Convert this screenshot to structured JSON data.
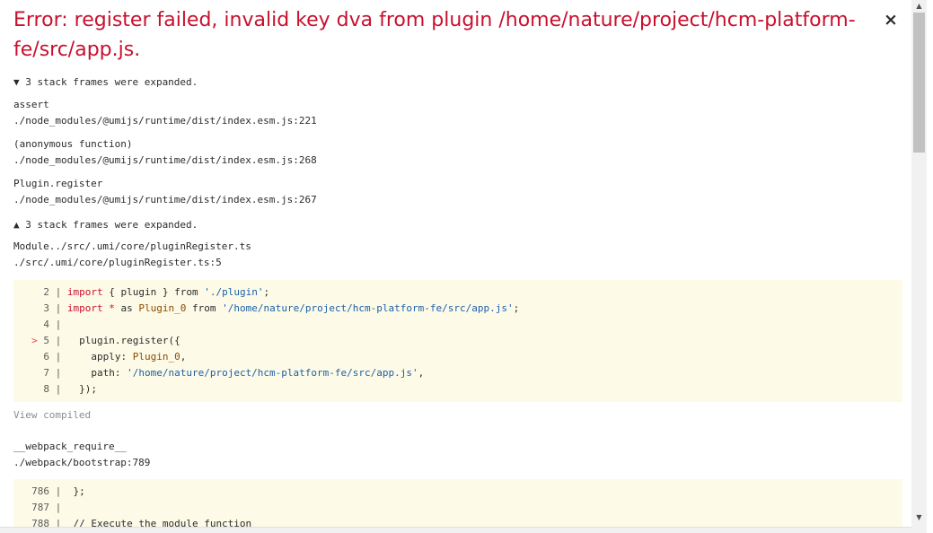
{
  "error": {
    "title": "Error: register failed, invalid key dva from plugin /home/nature/project/hcm-platform-fe/src/app.js.",
    "close_label": "×"
  },
  "stack": {
    "toggle_expanded_1": "▼ 3 stack frames were expanded.",
    "frames_1": [
      {
        "fn": "assert",
        "loc": "./node_modules/@umijs/runtime/dist/index.esm.js:221"
      },
      {
        "fn": "(anonymous function)",
        "loc": "./node_modules/@umijs/runtime/dist/index.esm.js:268"
      },
      {
        "fn": "Plugin.register",
        "loc": "./node_modules/@umijs/runtime/dist/index.esm.js:267"
      }
    ],
    "toggle_expanded_2": "▲ 3 stack frames were expanded.",
    "frame_2": {
      "fn": "Module../src/.umi/core/pluginRegister.ts",
      "loc": "./src/.umi/core/pluginRegister.ts:5"
    },
    "view_compiled": "View compiled",
    "frame_3": {
      "fn": "__webpack_require__",
      "loc": "./webpack/bootstrap:789"
    }
  },
  "code_block_1": {
    "lines": [
      {
        "no": "2",
        "marker": "",
        "tokens": [
          [
            "kw",
            "import"
          ],
          [
            "t",
            " { plugin } "
          ],
          [
            "t",
            "from"
          ],
          [
            "t",
            " "
          ],
          [
            "str",
            "'./plugin'"
          ],
          [
            "t",
            ";"
          ]
        ]
      },
      {
        "no": "3",
        "marker": "",
        "tokens": [
          [
            "kw",
            "import"
          ],
          [
            "t",
            " "
          ],
          [
            "kw",
            "*"
          ],
          [
            "t",
            " as "
          ],
          [
            "ident",
            "Plugin_0"
          ],
          [
            "t",
            " from "
          ],
          [
            "str",
            "'/home/nature/project/hcm-platform-fe/src/app.js'"
          ],
          [
            "t",
            ";"
          ]
        ]
      },
      {
        "no": "4",
        "marker": "",
        "tokens": []
      },
      {
        "no": "5",
        "marker": ">",
        "tokens": [
          [
            "t",
            "  plugin.register({"
          ]
        ]
      },
      {
        "no": "6",
        "marker": "",
        "tokens": [
          [
            "t",
            "    apply: "
          ],
          [
            "ident",
            "Plugin_0"
          ],
          [
            "t",
            ","
          ]
        ]
      },
      {
        "no": "7",
        "marker": "",
        "tokens": [
          [
            "t",
            "    path: "
          ],
          [
            "str",
            "'/home/nature/project/hcm-platform-fe/src/app.js'"
          ],
          [
            "t",
            ","
          ]
        ]
      },
      {
        "no": "8",
        "marker": "",
        "tokens": [
          [
            "t",
            "  });"
          ]
        ]
      }
    ]
  },
  "code_block_2": {
    "lines": [
      {
        "no": "786",
        "marker": "",
        "tokens": [
          [
            "t",
            " };"
          ]
        ]
      },
      {
        "no": "787",
        "marker": "",
        "tokens": []
      },
      {
        "no": "788",
        "marker": "",
        "tokens": [
          [
            "t",
            " // Execute the module function"
          ]
        ]
      }
    ]
  },
  "colors": {
    "error_red": "#c8102e",
    "code_bg": "#fdfbe7",
    "string_blue": "#1c5fa8",
    "muted_gray": "#878e91"
  }
}
